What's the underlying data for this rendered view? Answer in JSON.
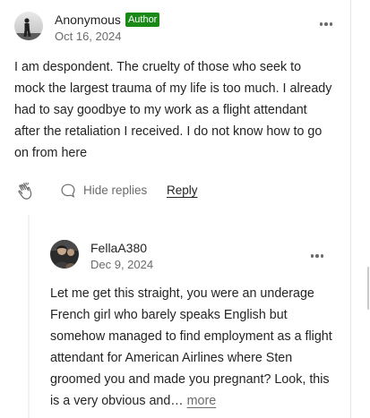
{
  "comments": [
    {
      "author": "Anonymous",
      "badge": "Author",
      "date": "Oct 16, 2024",
      "body": "I am despondent. The cruelty of those who seek to mock the largest trauma of my life is too much. I already had to say goodbye to my work as a flight attendant after the retaliation I received. I do not know how to go on from here",
      "avatar_icon": "anonymous-silhouette-avatar"
    },
    {
      "author": "FellaA380",
      "date": "Dec 9, 2024",
      "body": "Let me get this straight, you were an underage French girl who barely speaks English but somehow managed to find employment as a flight attendant for American Airlines where Sten groomed you and made you pregnant? Look, this is a very obvious and…",
      "more_label": "more",
      "avatar_icon": "profile-photo-avatar"
    }
  ],
  "actions": {
    "clap_icon": "clap-icon",
    "hide_replies_label": "Hide replies",
    "reply_label": "Reply"
  },
  "colors": {
    "badge_green": "#1a8917",
    "text_primary": "#242424",
    "text_secondary": "#6b6b6b",
    "thread_line": "#f2f2f2"
  }
}
